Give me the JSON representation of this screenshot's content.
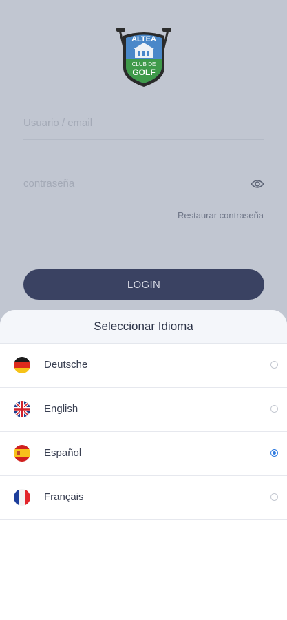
{
  "login": {
    "logo": {
      "line1": "ALTEA",
      "line2": "CLUB DE",
      "line3": "GOLF"
    },
    "username_placeholder": "Usuario / email",
    "password_placeholder": "contraseña",
    "restore_link": "Restaurar contraseña",
    "login_button": "LOGIN"
  },
  "language_sheet": {
    "title": "Seleccionar Idioma",
    "languages": [
      {
        "label": "Deutsche",
        "flag": "germany-flag",
        "selected": false
      },
      {
        "label": "English",
        "flag": "uk-flag",
        "selected": false
      },
      {
        "label": "Español",
        "flag": "spain-flag",
        "selected": true
      },
      {
        "label": "Français",
        "flag": "france-flag",
        "selected": false
      }
    ]
  },
  "colors": {
    "backdrop": "#c1c6d1",
    "primary_button": "#3a4262",
    "radio_selected": "#2f7be0"
  }
}
